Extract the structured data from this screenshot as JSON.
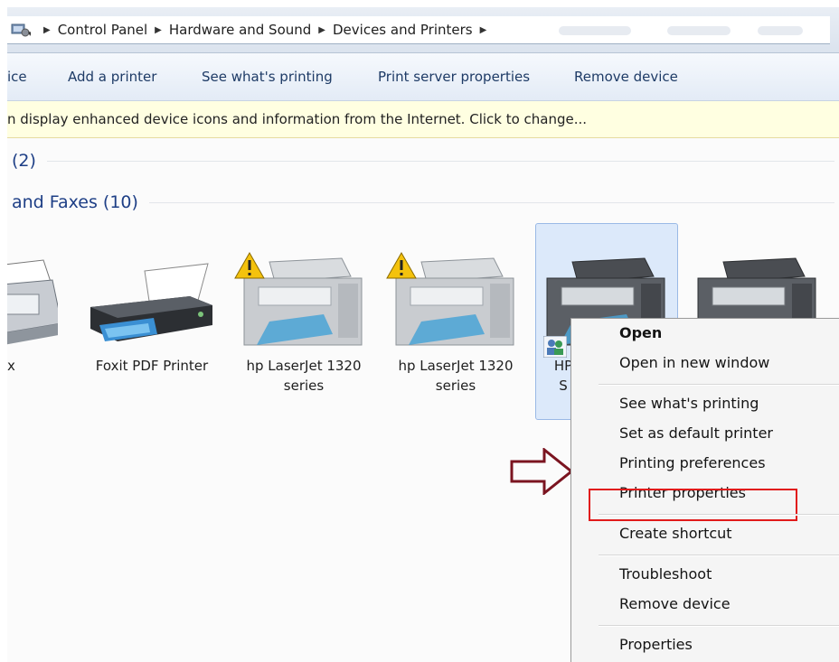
{
  "breadcrumb": [
    "Control Panel",
    "Hardware and Sound",
    "Devices and Printers"
  ],
  "commands": [
    "ice",
    "Add a printer",
    "See what's printing",
    "Print server properties",
    "Remove device"
  ],
  "infobar_text": "n display enhanced device icons and information from the Internet. Click to change...",
  "groups": {
    "devices": "(2)",
    "printers": "and Faxes (10)"
  },
  "devices": [
    {
      "label_1": "x",
      "label_2": ""
    },
    {
      "label_1": "Foxit PDF Printer",
      "label_2": ""
    },
    {
      "label_1": "hp LaserJet 1320",
      "label_2": "series"
    },
    {
      "label_1": "hp LaserJet 1320",
      "label_2": "series"
    },
    {
      "label_1": "HP",
      "label_2": "S"
    }
  ],
  "context_menu": {
    "open": "Open",
    "open_new_window": "Open in new window",
    "see_printing": "See what's printing",
    "set_default": "Set as default printer",
    "printing_preferences": "Printing preferences",
    "printer_properties": "Printer properties",
    "create_shortcut": "Create shortcut",
    "troubleshoot": "Troubleshoot",
    "remove_device": "Remove device",
    "properties": "Properties"
  },
  "icons": {
    "address": "control-panel-icon",
    "breadcrumb_separator": "triangle-right-icon",
    "warning": "warning-icon",
    "shared": "shared-users-icon",
    "callout_arrow": "outline-arrow-right-icon"
  },
  "colors": {
    "highlight_box": "#e11a1a",
    "callout_arrow": "#7b1420",
    "group_header": "#1e3f86",
    "selected_tile": "#dce9fa"
  }
}
